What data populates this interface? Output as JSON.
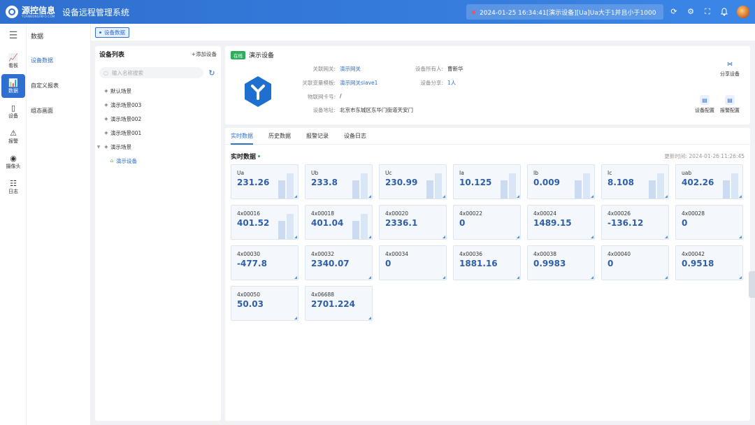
{
  "header": {
    "brand": "源控信息",
    "brand_sub": "YUANKONGINFO.COM",
    "system_title": "设备远程管理系统",
    "alarm_text": "2024-01-25 16:34:41[演示设备][Ua]Ua大于1并且小于1000",
    "icons": [
      "refresh-icon",
      "settings-icon",
      "fullscreen-icon",
      "bell-icon"
    ]
  },
  "rail": {
    "items": [
      {
        "label": "看板",
        "icon": "dashboard-icon"
      },
      {
        "label": "数据",
        "icon": "data-icon",
        "active": true
      },
      {
        "label": "设备",
        "icon": "device-icon"
      },
      {
        "label": "报警",
        "icon": "alarm-icon"
      },
      {
        "label": "摄像头",
        "icon": "camera-icon"
      },
      {
        "label": "日志",
        "icon": "log-icon"
      }
    ]
  },
  "submenu": {
    "title": "数据",
    "items": [
      {
        "label": "设备数据",
        "active": true
      },
      {
        "label": "自定义报表"
      },
      {
        "label": "组态画面"
      }
    ]
  },
  "page_tab": "设备数据",
  "device_list": {
    "title": "设备列表",
    "add_label": "+添加设备",
    "search_placeholder": "输入名称搜索",
    "nodes": [
      {
        "label": "默认场景"
      },
      {
        "label": "演示场景003"
      },
      {
        "label": "演示场景002"
      },
      {
        "label": "演示场景001"
      },
      {
        "label": "演示场景"
      }
    ],
    "child": "演示设备"
  },
  "device": {
    "status": "在线",
    "name": "演示设备",
    "fields": {
      "gateway_k": "关联网关:",
      "gateway_v": "演示网关",
      "template_k": "关联变量模板:",
      "template_v": "演示网关slave1",
      "iot_k": "物联网卡号:",
      "iot_v": "/",
      "address_k": "设备地址:",
      "address_v": "北京市东城区东华门街道天安门",
      "owner_k": "设备所有人:",
      "owner_v": "曹新华",
      "share_k": "设备分享:",
      "share_v": "1人"
    },
    "actions": {
      "share": "分享设备",
      "config": "设备配置",
      "alarm_config": "报警配置"
    }
  },
  "tabs": [
    "实时数据",
    "历史数据",
    "报警记录",
    "设备日志"
  ],
  "realtime": {
    "title": "实时数据",
    "updated": "更新时间: 2024-01-26 11:26:45",
    "cells": [
      {
        "label": "Ua",
        "value": "231.26",
        "bars": true
      },
      {
        "label": "Ub",
        "value": "233.8",
        "bars": true
      },
      {
        "label": "Uc",
        "value": "230.99",
        "bars": true
      },
      {
        "label": "Ia",
        "value": "10.125",
        "bars": true
      },
      {
        "label": "Ib",
        "value": "0.009",
        "bars": true
      },
      {
        "label": "Ic",
        "value": "8.108",
        "bars": true
      },
      {
        "label": "uab",
        "value": "402.26",
        "bars": true
      },
      {
        "label": "4x00016",
        "value": "401.52",
        "bars": true
      },
      {
        "label": "4x00018",
        "value": "401.04",
        "bars": true
      },
      {
        "label": "4x00020",
        "value": "2336.1",
        "bars": false
      },
      {
        "label": "4x00022",
        "value": "0",
        "bars": false
      },
      {
        "label": "4x00024",
        "value": "1489.15",
        "bars": false
      },
      {
        "label": "4x00026",
        "value": "-136.12",
        "bars": false
      },
      {
        "label": "4x00028",
        "value": "0",
        "bars": false
      },
      {
        "label": "4x00030",
        "value": "-477.8",
        "bars": false
      },
      {
        "label": "4x00032",
        "value": "2340.07",
        "bars": false
      },
      {
        "label": "4x00034",
        "value": "0",
        "bars": false
      },
      {
        "label": "4x00036",
        "value": "1881.16",
        "bars": false
      },
      {
        "label": "4x00038",
        "value": "0.9983",
        "bars": false
      },
      {
        "label": "4x00040",
        "value": "0",
        "bars": false
      },
      {
        "label": "4x00042",
        "value": "0.9518",
        "bars": false
      },
      {
        "label": "4x00050",
        "value": "50.03",
        "bars": false
      },
      {
        "label": "4x06688",
        "value": "2701.224",
        "bars": false
      }
    ]
  }
}
